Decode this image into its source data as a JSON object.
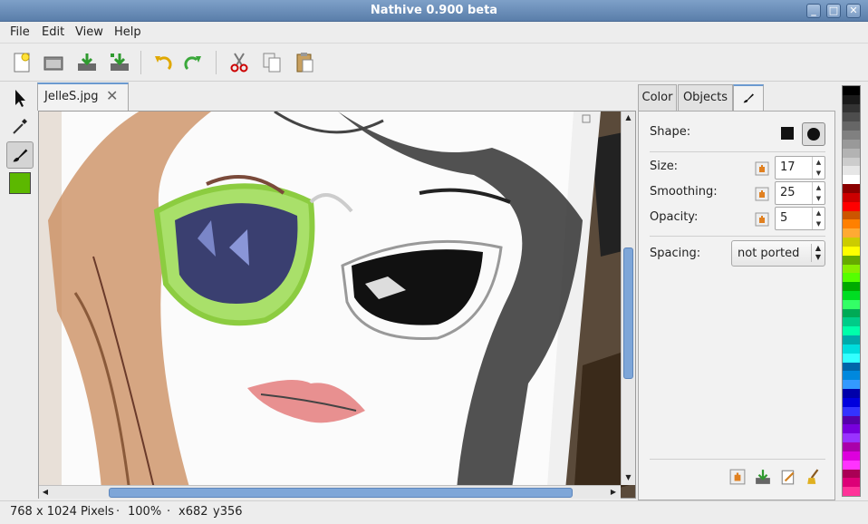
{
  "window": {
    "title": "Nathive 0.900 beta"
  },
  "menu": {
    "items": [
      "File",
      "Edit",
      "View",
      "Help"
    ]
  },
  "toolbar": {
    "buttons": [
      "new-icon",
      "open-icon",
      "save-icon",
      "save-as-icon",
      "undo-icon",
      "redo-icon",
      "cut-icon",
      "copy-icon",
      "paste-icon"
    ]
  },
  "tools": [
    "pointer-icon",
    "eyedropper-icon",
    "brush-icon"
  ],
  "foreground_color": "#5cb800",
  "document": {
    "tab_label": "JelleS.jpg"
  },
  "panel": {
    "tabs": [
      "Color",
      "Objects"
    ],
    "shape_label": "Shape:",
    "size_label": "Size:",
    "size_value": "17",
    "smoothing_label": "Smoothing:",
    "smoothing_value": "25",
    "opacity_label": "Opacity:",
    "opacity_value": "5",
    "spacing_label": "Spacing:",
    "spacing_value": "not ported"
  },
  "palette": [
    "#000000",
    "#1a1a1a",
    "#333333",
    "#4d4d4d",
    "#666666",
    "#808080",
    "#999999",
    "#b3b3b3",
    "#cccccc",
    "#e6e6e6",
    "#ffffff",
    "#8b0000",
    "#cc0000",
    "#ff0000",
    "#cc5500",
    "#ff8000",
    "#ffaa33",
    "#cccc00",
    "#ffff00",
    "#66aa00",
    "#88ee00",
    "#55ff00",
    "#00aa00",
    "#00dd22",
    "#33ff66",
    "#00aa55",
    "#00cc88",
    "#00ffaa",
    "#00aaaa",
    "#00dddd",
    "#33ffff",
    "#0066aa",
    "#0088dd",
    "#3399ff",
    "#0000aa",
    "#0000dd",
    "#3333ff",
    "#5500aa",
    "#7700dd",
    "#9933ff",
    "#aa00aa",
    "#dd00dd",
    "#ff33ff",
    "#aa0055",
    "#dd0077",
    "#ff3399"
  ],
  "status": {
    "dims": "768 x 1024 Pixels",
    "dot1": "·",
    "zoom": "100%",
    "dot2": "·",
    "x": "x682",
    "y": "y356"
  }
}
